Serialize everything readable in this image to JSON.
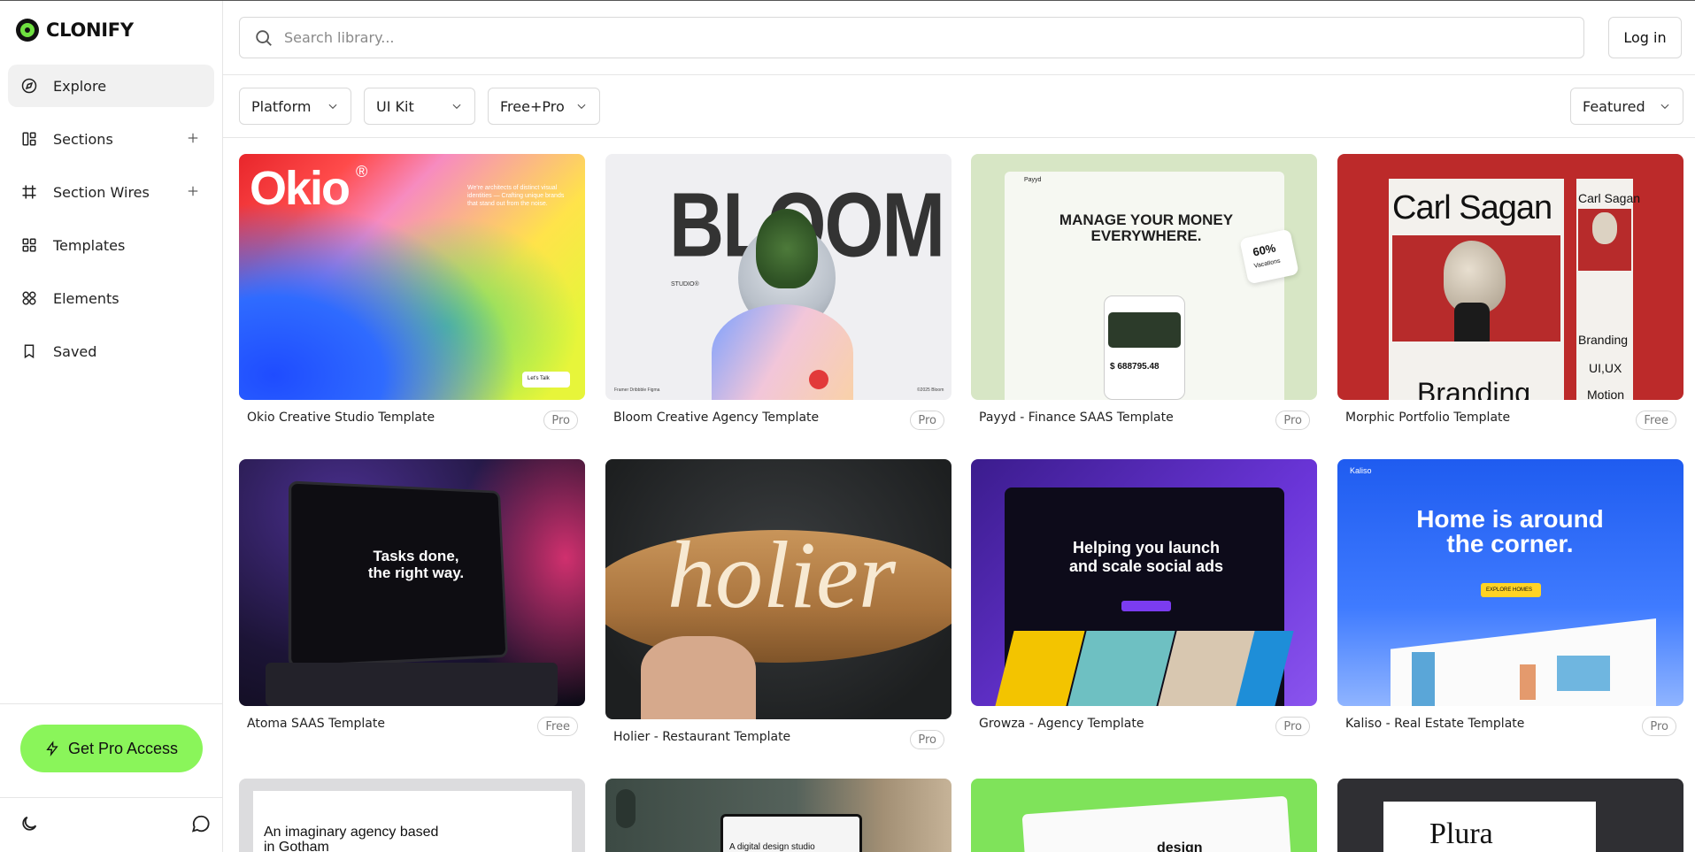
{
  "brand": {
    "name": "CLONIFY",
    "accent": "#8af55a"
  },
  "nav": {
    "items": [
      {
        "label": "Explore",
        "icon": "compass-icon",
        "active": true,
        "has_plus": false
      },
      {
        "label": "Sections",
        "icon": "layout-icon",
        "active": false,
        "has_plus": true
      },
      {
        "label": "Section Wires",
        "icon": "frame-icon",
        "active": false,
        "has_plus": true
      },
      {
        "label": "Templates",
        "icon": "grid-icon",
        "active": false,
        "has_plus": false
      },
      {
        "label": "Elements",
        "icon": "elements-icon",
        "active": false,
        "has_plus": false
      },
      {
        "label": "Saved",
        "icon": "bookmark-icon",
        "active": false,
        "has_plus": false
      }
    ]
  },
  "pro": {
    "label": "Get Pro Access",
    "icon": "lightning-icon"
  },
  "footer_icons": [
    "moon-icon",
    "chat-icon"
  ],
  "search": {
    "placeholder": "Search library...",
    "value": ""
  },
  "header": {
    "login_label": "Log in"
  },
  "filters": {
    "platform": "Platform",
    "ui_kit": "UI Kit",
    "pricing": "Free+Pro",
    "sort": "Featured"
  },
  "cards": [
    {
      "title": "Okio Creative Studio Template",
      "badge": "Pro"
    },
    {
      "title": "Bloom Creative Agency Template",
      "badge": "Pro"
    },
    {
      "title": "Payyd - Finance SAAS Template",
      "badge": "Pro"
    },
    {
      "title": "Morphic Portfolio Template",
      "badge": "Free"
    },
    {
      "title": "Atoma SAAS Template",
      "badge": "Free"
    },
    {
      "title": "Holier - Restaurant Template",
      "badge": "Pro"
    },
    {
      "title": "Growza - Agency Template",
      "badge": "Pro"
    },
    {
      "title": "Kaliso - Real Estate Template",
      "badge": "Pro"
    }
  ],
  "thumbs": {
    "okio": {
      "logo": "Okio",
      "reg": "®",
      "tagline": "We're architects of distinct visual identities — Crafting unique brands that stand out from the noise.",
      "cta": "Let's Talk"
    },
    "bloom": {
      "word": "BLOOM",
      "sub": "STUDIO®",
      "footer_left": "Framer  Dribbble  Figma",
      "footer_right": "©2025 Bloom"
    },
    "payyd": {
      "logo": "Payyd",
      "headline": "MANAGE YOUR MONEY EVERYWHERE.",
      "stat": "60%",
      "stat_label": "Vacations",
      "amount": "$ 688795.48"
    },
    "morphic": {
      "name": "Carl Sagan",
      "word": "Branding",
      "side1": "Carl Sagan",
      "side2": "Branding",
      "side3": "UI,UX",
      "side4": "Motion"
    },
    "atoma": {
      "headline": "Tasks done, the right way."
    },
    "holier": {
      "word": "holier"
    },
    "growza": {
      "headline": "Helping you launch and scale social ads"
    },
    "kaliso": {
      "logo": "Kaliso",
      "headline": "Home is around the corner.",
      "cta": "EXPLORE HOMES"
    },
    "row3": {
      "agency": "An imaginary agency based in Gotham",
      "digital": "A digital design studio",
      "plura": "Plura",
      "design": "design"
    }
  }
}
